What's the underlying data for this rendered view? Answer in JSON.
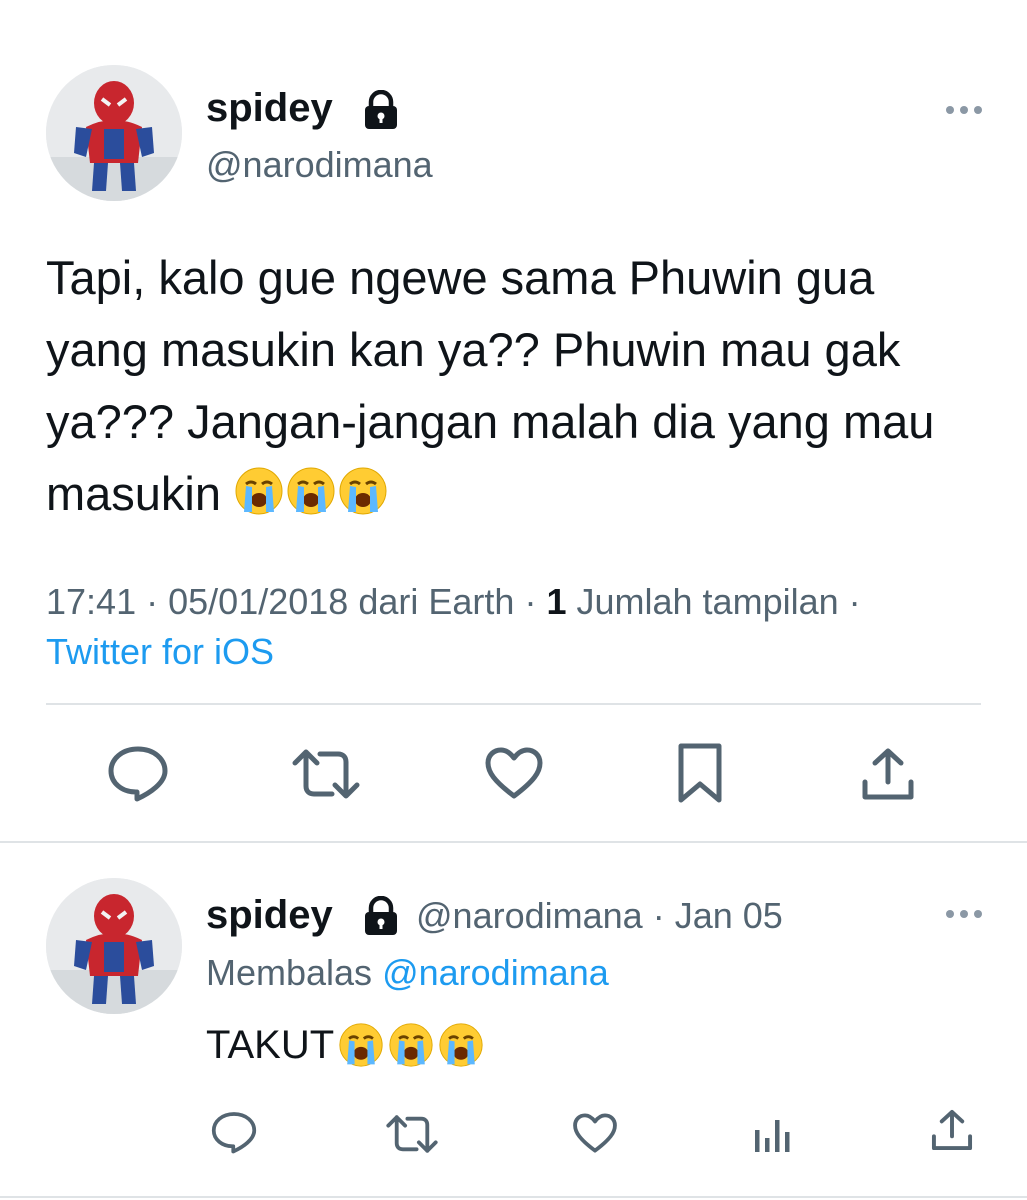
{
  "tweet": {
    "author_name": "spidey",
    "handle": "@narodimana",
    "text": "Tapi, kalo gue ngewe sama Phuwin gua yang masukin kan ya?? Phuwin mau gak ya??? Jangan-jangan malah dia yang mau masukin",
    "emojis": [
      "loudly-crying-face",
      "loudly-crying-face",
      "loudly-crying-face"
    ],
    "time": "17:41",
    "date": "05/01/2018",
    "location_prefix": "dari",
    "location": "Earth",
    "views_count": "1",
    "views_label": "Jumlah tampilan",
    "separator": "·",
    "source": "Twitter for iOS",
    "actions": [
      "reply-icon",
      "retweet-icon",
      "like-icon",
      "bookmark-icon",
      "share-icon"
    ]
  },
  "reply": {
    "author_name": "spidey",
    "handle": "@narodimana",
    "separator": "·",
    "date": "Jan 05",
    "replying_label": "Membalas",
    "replying_to": "@narodimana",
    "text": "TAKUT",
    "emojis": [
      "loudly-crying-face",
      "loudly-crying-face",
      "loudly-crying-face"
    ],
    "actions": [
      "reply-icon",
      "retweet-icon",
      "like-icon",
      "analytics-icon",
      "share-icon"
    ]
  },
  "colors": {
    "text": "#0f1419",
    "secondary": "#536471",
    "link": "#1d9bf0",
    "divider": "#dfe3e6"
  }
}
